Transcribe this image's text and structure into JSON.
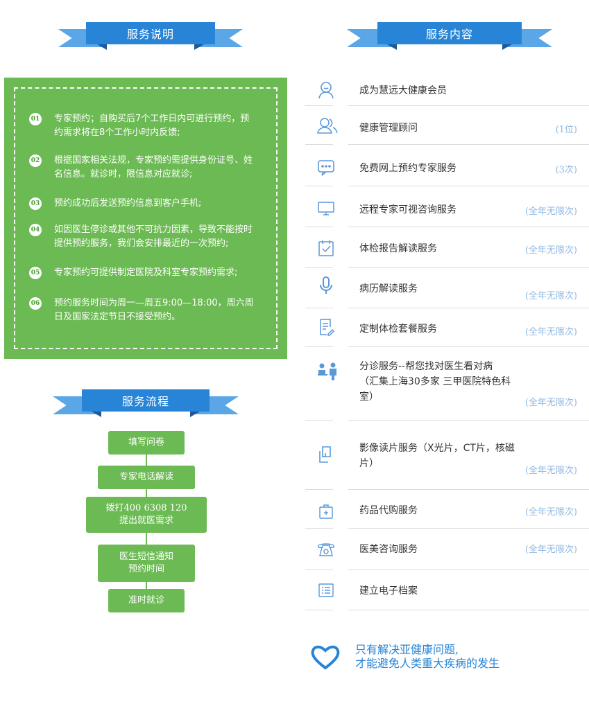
{
  "headings": {
    "service_desc": "服务说明",
    "service_content": "服务内容",
    "service_flow": "服务流程"
  },
  "description": [
    {
      "num": "01",
      "text": "专家预约；自购买后7个工作日内可进行预约，预约需求将在8个工作小时内反馈;"
    },
    {
      "num": "02",
      "text": "根据国家相关法规，专家预约需提供身份证号、姓名信息。就诊时，限信息对应就诊;"
    },
    {
      "num": "03",
      "text": "预约成功后发送预约信息到客户手机;"
    },
    {
      "num": "04",
      "text": "如因医生停诊或其他不可抗力因素，导致不能按时提供预约服务，我们会安排最近的一次预约;"
    },
    {
      "num": "05",
      "text": "专家预约可提供制定医院及科室专家预约需求;"
    },
    {
      "num": "06",
      "text": "预约服务时间为周一—周五9:00—18:00，周六周日及国家法定节日不接受预约。"
    }
  ],
  "flow": [
    {
      "line1": "填写问卷",
      "line2": ""
    },
    {
      "line1": "专家电话解读",
      "line2": ""
    },
    {
      "line1": "拨打400  6308  120",
      "line2": "提出就医需求"
    },
    {
      "line1": "医生短信通知",
      "line2": "预约时间"
    },
    {
      "line1": "准时就诊",
      "line2": ""
    }
  ],
  "services": [
    {
      "icon": "user-icon",
      "label": "成为慧远大健康会员",
      "count": ""
    },
    {
      "icon": "users-icon",
      "label": "健康管理顾问",
      "count": "(1位)"
    },
    {
      "icon": "chat-icon",
      "label": "免费网上预约专家服务",
      "count": "(3次)"
    },
    {
      "icon": "monitor-icon",
      "label": "远程专家可视咨询服务",
      "count": "(全年无限次)"
    },
    {
      "icon": "calendar-check-icon",
      "label": "体检报告解读服务",
      "count": "(全年无限次)"
    },
    {
      "icon": "microphone-icon",
      "label": "病历解读服务",
      "count": "(全年无限次)"
    },
    {
      "icon": "document-edit-icon",
      "label": "定制体检套餐服务",
      "count": "(全年无限次)"
    },
    {
      "icon": "doctor-icon",
      "label": "分诊服务--帮您找对医生看对病（汇集上海30多家 三甲医院特色科室）",
      "count": "(全年无限次)"
    },
    {
      "icon": "copy-icon",
      "label": "影像读片服务（X光片，CT片，核磁片）",
      "count": "(全年无限次)"
    },
    {
      "icon": "medkit-icon",
      "label": "药品代购服务",
      "count": "(全年无限次)"
    },
    {
      "icon": "telephone-icon",
      "label": "医美咨询服务",
      "count": "(全年无限次)"
    },
    {
      "icon": "list-icon",
      "label": "建立电子档案",
      "count": ""
    }
  ],
  "footer": {
    "line1": "只有解决亚健康问题,",
    "line2": "才能避免人类重大疾病的发生"
  },
  "colors": {
    "green": "#6cba53",
    "blue": "#2784d6",
    "light_blue": "#5aa6e6",
    "count_text": "#8fb7e2"
  }
}
